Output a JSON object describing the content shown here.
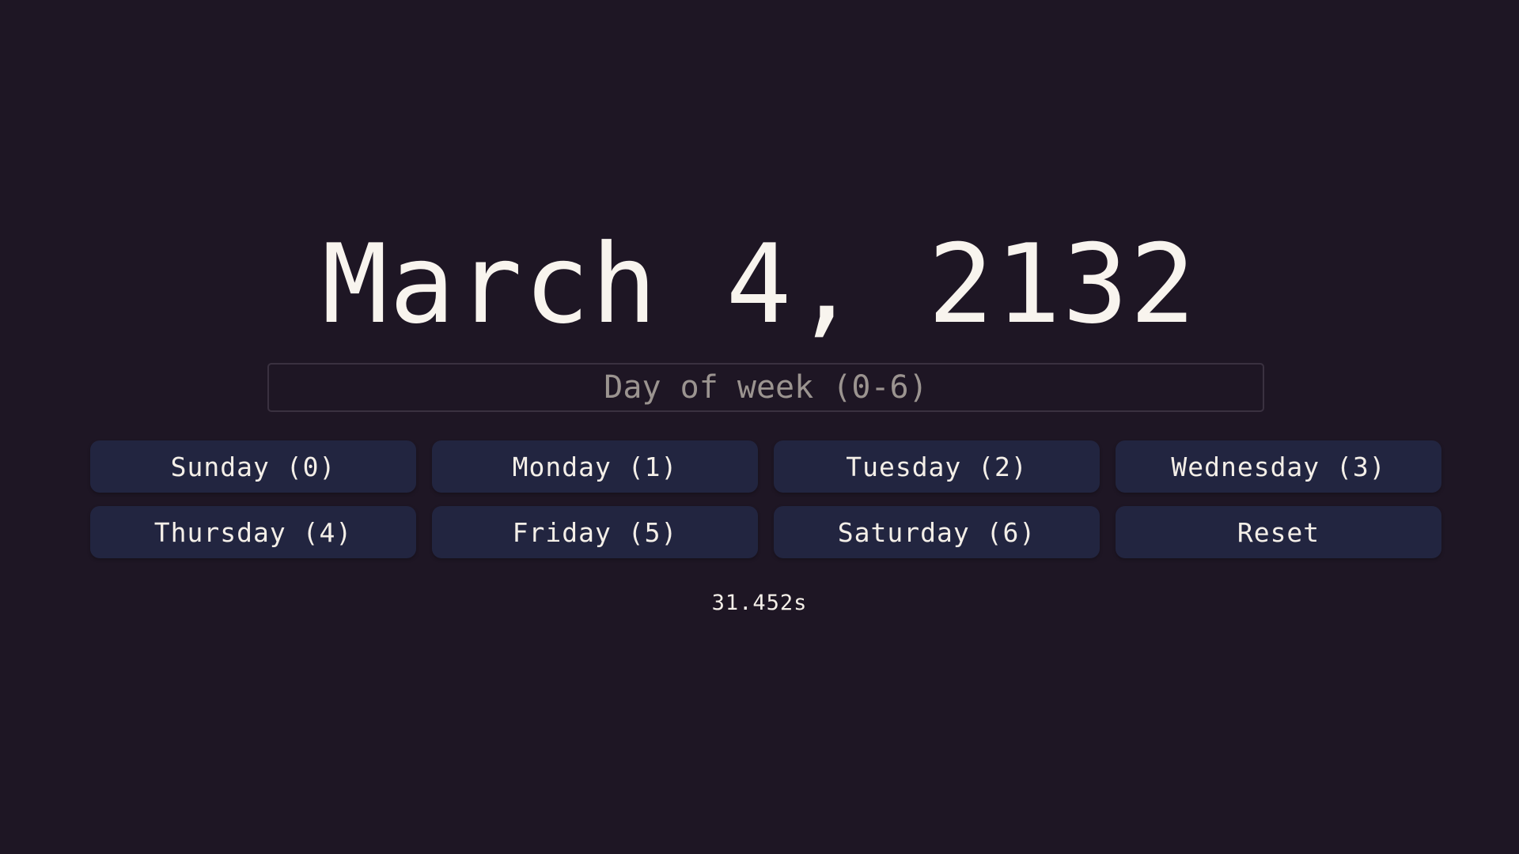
{
  "header": {
    "date": "March 4, 2132"
  },
  "input": {
    "placeholder": "Day of week (0-6)",
    "value": ""
  },
  "buttons": [
    {
      "label": "Sunday (0)"
    },
    {
      "label": "Monday (1)"
    },
    {
      "label": "Tuesday (2)"
    },
    {
      "label": "Wednesday (3)"
    },
    {
      "label": "Thursday (4)"
    },
    {
      "label": "Friday (5)"
    },
    {
      "label": "Saturday (6)"
    },
    {
      "label": "Reset"
    }
  ],
  "timer": {
    "elapsed": "31.452s"
  },
  "colors": {
    "background": "#1e1624",
    "button": "#222540",
    "text": "#f8f4ee",
    "placeholder": "#9b9490",
    "input_border": "#3a3140"
  }
}
